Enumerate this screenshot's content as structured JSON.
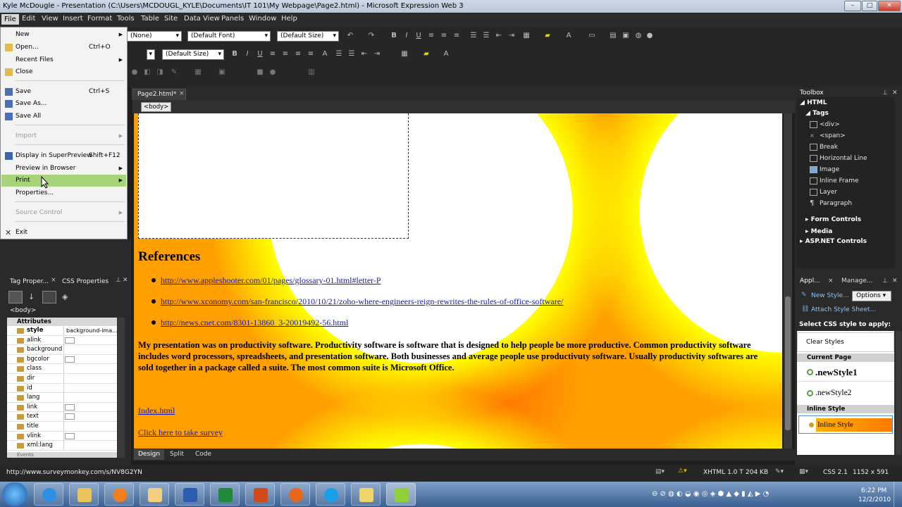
{
  "window": {
    "title": "Kyle McDougle - Presentation (C:\\Users\\MCDOUGL_KYLE\\Documents\\IT 101\\My Webpage\\Page2.html) - Microsoft Expression Web 3",
    "btn_min": "–",
    "btn_max": "□",
    "btn_close": "✕"
  },
  "menubar": [
    "File",
    "Edit",
    "View",
    "Insert",
    "Format",
    "Tools",
    "Table",
    "Site",
    "Data View",
    "Panels",
    "Window",
    "Help"
  ],
  "toolbar": {
    "style_select": "(None)",
    "font_select": "(Default Font)",
    "size_select_1": "(Default Size)",
    "size_select_2": "(Default Size)",
    "bold": "B",
    "italic": "I",
    "underline": "U",
    "font_color": "A"
  },
  "file_menu": [
    {
      "label": "New",
      "shortcut": "",
      "submenu": true,
      "disabled": false
    },
    {
      "label": "Open...",
      "shortcut": "Ctrl+O",
      "submenu": false,
      "disabled": false
    },
    {
      "label": "Recent Files",
      "shortcut": "",
      "submenu": true,
      "disabled": false
    },
    {
      "label": "Close",
      "shortcut": "",
      "submenu": false,
      "disabled": false
    },
    {
      "label": "Save",
      "shortcut": "Ctrl+S",
      "submenu": false,
      "disabled": false
    },
    {
      "label": "Save As...",
      "shortcut": "",
      "submenu": false,
      "disabled": false
    },
    {
      "label": "Save All",
      "shortcut": "",
      "submenu": false,
      "disabled": false
    },
    {
      "label": "Import",
      "shortcut": "",
      "submenu": true,
      "disabled": true
    },
    {
      "label": "Display in SuperPreview",
      "shortcut": "Shift+F12",
      "submenu": false,
      "disabled": false
    },
    {
      "label": "Preview in Browser",
      "shortcut": "",
      "submenu": true,
      "disabled": false
    },
    {
      "label": "Print",
      "shortcut": "",
      "submenu": true,
      "disabled": false,
      "highlighted": true
    },
    {
      "label": "Properties...",
      "shortcut": "",
      "submenu": false,
      "disabled": false
    },
    {
      "label": "Source Control",
      "shortcut": "",
      "submenu": true,
      "disabled": true
    },
    {
      "label": "Exit",
      "shortcut": "",
      "submenu": false,
      "disabled": false
    }
  ],
  "document": {
    "tab_label": "Page2.html*",
    "tab_close": "×",
    "breadcrumb": "<body>",
    "heading": "References",
    "links": [
      "http://www.appleshooter.com/01/pages/glossary-01.html#letter-P",
      "http://www.xconomy.com/san-francisco/2010/10/21/zoho-where-engineers-reign-rewrites-the-rules-of-office-software/",
      "http://news.cnet.com/8301-13860_3-20019492-56.html"
    ],
    "paragraph": "My presentation was on productivity software.  Productivity software is software that is designed to help people be more productive.  Common productivity software includes word processors, spreadsheets, and presentation software.  Both businesses and average people use productivuty software.  Usually productivity softwares are sold together in a package called a suite.  The most common suite is Microsoft Office.",
    "index_link": "Index.html",
    "survey_link": "Click here to take survey",
    "view_tabs": [
      "Design",
      "Split",
      "Code"
    ]
  },
  "left_panel": {
    "tabs": [
      "Tag Proper...",
      "CSS Properties"
    ],
    "tag": "<body>",
    "section_attributes": "Attributes",
    "section_events": "Events",
    "attributes": [
      {
        "name": "style",
        "value": "background-ima...",
        "bold": true,
        "checkbox": false
      },
      {
        "name": "alink",
        "value": "",
        "checkbox": true
      },
      {
        "name": "background",
        "value": "",
        "checkbox": false
      },
      {
        "name": "bgcolor",
        "value": "",
        "checkbox": true
      },
      {
        "name": "class",
        "value": "",
        "checkbox": false
      },
      {
        "name": "dir",
        "value": "",
        "checkbox": false
      },
      {
        "name": "id",
        "value": "",
        "checkbox": false
      },
      {
        "name": "lang",
        "value": "",
        "checkbox": false
      },
      {
        "name": "link",
        "value": "",
        "checkbox": true
      },
      {
        "name": "text",
        "value": "",
        "checkbox": true
      },
      {
        "name": "title",
        "value": "",
        "checkbox": false
      },
      {
        "name": "vlink",
        "value": "",
        "checkbox": true
      },
      {
        "name": "xml:lang",
        "value": "",
        "checkbox": false
      }
    ]
  },
  "toolbox": {
    "title": "Toolbox",
    "html": "HTML",
    "tags": "Tags",
    "items": [
      "<div>",
      "<span>",
      "Break",
      "Horizontal Line",
      "Image",
      "Inline Frame",
      "Layer",
      "Paragraph"
    ],
    "groups": [
      "Form Controls",
      "Media",
      "ASP.NET Controls"
    ]
  },
  "apply_styles": {
    "tabs": [
      "Appl...",
      "Manage..."
    ],
    "new_style": "New Style...",
    "options": "Options",
    "attach": "Attach Style Sheet...",
    "select_label": "Select CSS style to apply:",
    "clear": "Clear Styles",
    "current_page": "Current Page",
    "styles": [
      ".newStyle1",
      ".newStyle2"
    ],
    "inline_header": "Inline Style",
    "inline_item": "Inline Style"
  },
  "statusbar": {
    "url": "http://www.surveymonkey.com/s/NV8G2YN",
    "doctype": "XHTML 1.0 T",
    "size": "204 KB",
    "css": "CSS 2.1",
    "dimensions": "1152 x 591"
  },
  "taskbar": {
    "time": "6:22 PM",
    "date": "12/2/2010"
  },
  "colors": {
    "menu_highlight": "#a8d479",
    "gradient_orange": "#ff8000",
    "gradient_yellow": "#ffff00"
  }
}
